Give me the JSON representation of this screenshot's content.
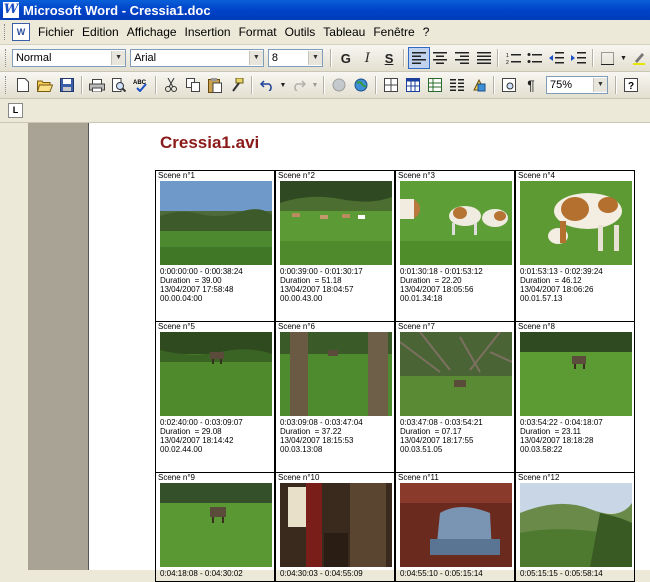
{
  "window": {
    "title": "Microsoft Word - Cressia1.doc"
  },
  "menu": [
    "Fichier",
    "Edition",
    "Affichage",
    "Insertion",
    "Format",
    "Outils",
    "Tableau",
    "Fenêtre",
    "?"
  ],
  "format_toolbar": {
    "style": "Normal",
    "font": "Arial",
    "size": "8"
  },
  "standard_toolbar": {
    "zoom": "75%"
  },
  "ruler": {
    "tab_selector": "L"
  },
  "document": {
    "title": "Cressia1.avi",
    "scenes": [
      {
        "label": "Scene n°1",
        "range": "0:00:00:00 - 0:00:38:24",
        "duration": "Duration  = 39.00",
        "date": "13/04/2007 17:58:48",
        "time": "00.00.04:00"
      },
      {
        "label": "Scene n°2",
        "range": "0:00:39:00 - 0:01:30:17",
        "duration": "Duration  = 51.18",
        "date": "13/04/2007 18:04:57",
        "time": "00.00.43.00"
      },
      {
        "label": "Scene n°3",
        "range": "0:01:30:18 - 0:01:53:12",
        "duration": "Duration  = 22.20",
        "date": "13/04/2007 18:05:56",
        "time": "00.01.34:18"
      },
      {
        "label": "Scene n°4",
        "range": "0:01:53:13 - 0:02:39:24",
        "duration": "Duration  = 46.12",
        "date": "13/04/2007 18:06:26",
        "time": "00.01.57.13"
      },
      {
        "label": "Scene n°5",
        "range": "0:02:40:00 - 0:03:09:07",
        "duration": "Duration  = 29.08",
        "date": "13/04/2007 18:14:42",
        "time": "00.02.44.00"
      },
      {
        "label": "Scene n°6",
        "range": "0:03:09:08 - 0:03:47:04",
        "duration": "Duration  = 37.22",
        "date": "13/04/2007 18:15:53",
        "time": "00.03.13:08"
      },
      {
        "label": "Scene n°7",
        "range": "0:03:47:08 - 0:03:54:21",
        "duration": "Duration  = 07.17",
        "date": "13/04/2007 18:17:55",
        "time": "00.03.51.05"
      },
      {
        "label": "Scene n°8",
        "range": "0:03:54:22 - 0:04:18:07",
        "duration": "Duration  = 23.11",
        "date": "13/04/2007 18:18:28",
        "time": "00.03.58:22"
      },
      {
        "label": "Scene n°9",
        "range": "0:04:18:08 - 0:04:30:02",
        "duration": "",
        "date": "",
        "time": ""
      },
      {
        "label": "Scene n°10",
        "range": "0:04:30:03 - 0:04:55:09",
        "duration": "",
        "date": "",
        "time": ""
      },
      {
        "label": "Scene n°11",
        "range": "0:04:55:10 - 0:05:15:14",
        "duration": "",
        "date": "",
        "time": ""
      },
      {
        "label": "Scene n°12",
        "range": "0:05:15:15 - 0:05:58:14",
        "duration": "",
        "date": "",
        "time": ""
      }
    ]
  }
}
